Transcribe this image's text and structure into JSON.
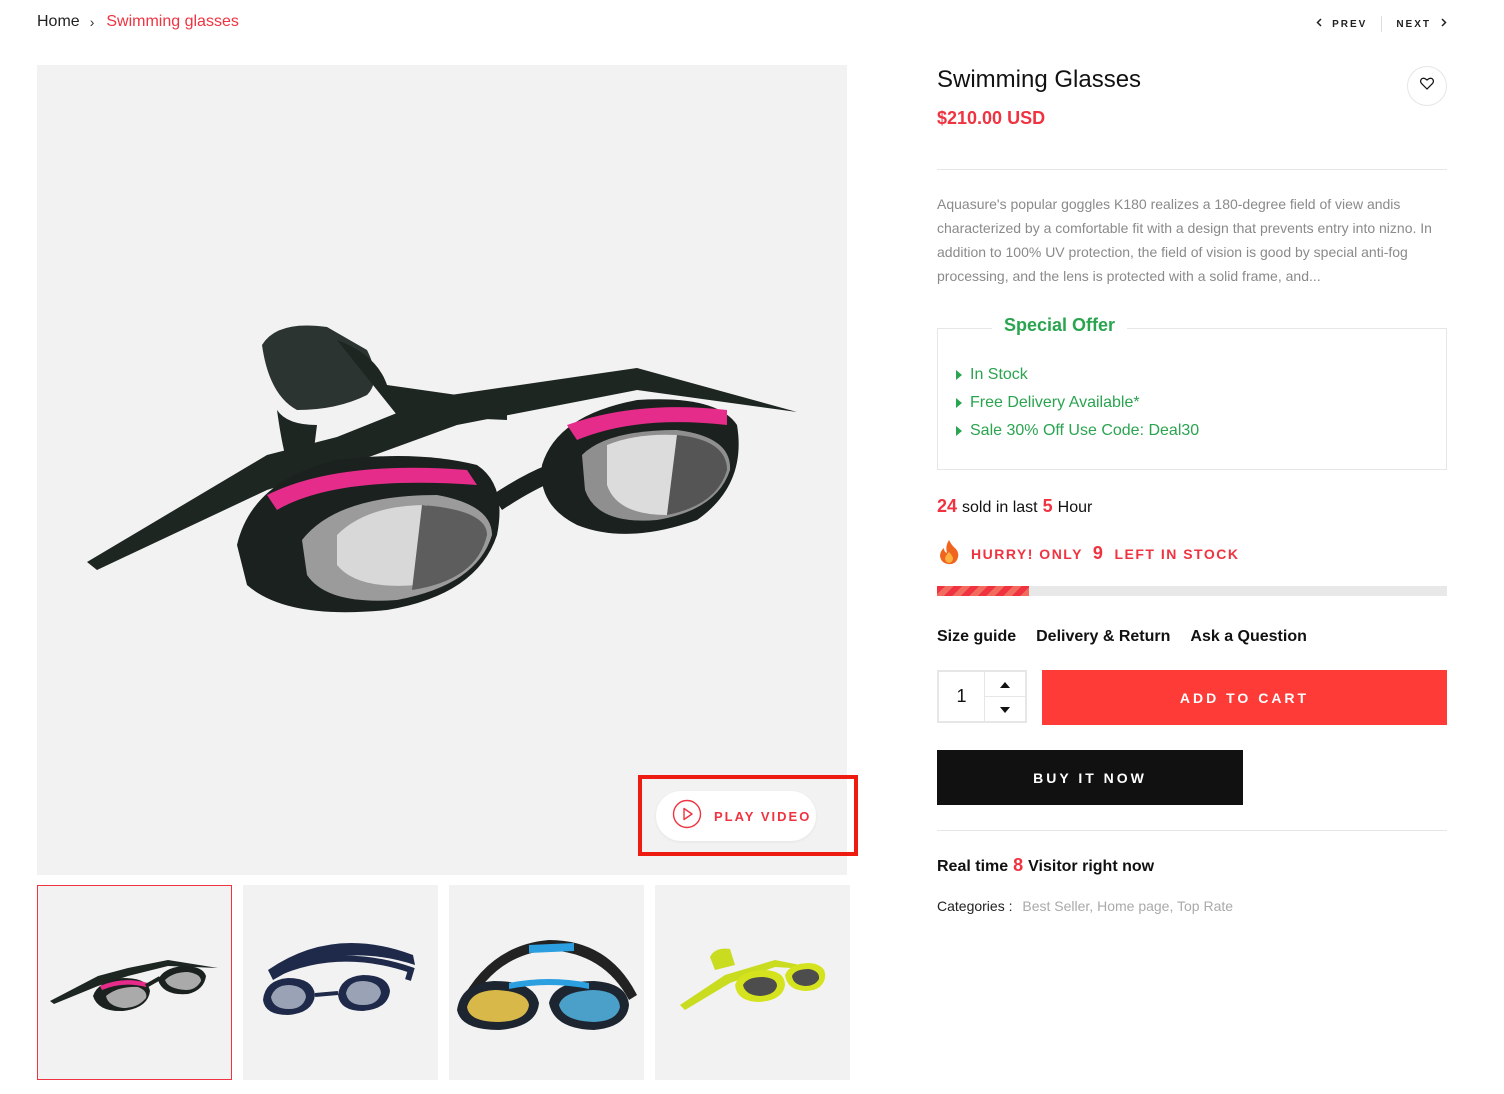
{
  "breadcrumb": {
    "home": "Home",
    "separator": "›",
    "current": "Swimming glasses"
  },
  "pager": {
    "prev": "PREV",
    "next": "NEXT"
  },
  "gallery": {
    "play_video": "PLAY VIDEO",
    "thumbnails": [
      "goggles-pink-black",
      "goggles-navy",
      "goggles-blue-yellow",
      "goggles-yellow-green"
    ]
  },
  "product": {
    "title": "Swimming Glasses",
    "price": "$210.00 USD",
    "description": "Aquasure's popular goggles K180 realizes a 180-degree field of view andis characterized by a comfortable fit with a design that prevents entry into nizno. In addition to 100% UV protection, the field of vision is good by special anti-fog processing, and the lens is protected with a solid frame, and...",
    "special_offer": {
      "title": "Special Offer",
      "items": [
        "In Stock",
        "Free Delivery Available*",
        "Sale 30% Off Use Code: Deal30"
      ]
    },
    "sold": {
      "count": "24",
      "text1": "sold in last",
      "hours": "5",
      "text2": "Hour"
    },
    "hurry": {
      "text1": "HURRY! ONLY",
      "count": "9",
      "text2": "LEFT IN STOCK",
      "stock_fraction": 0.18
    },
    "links": [
      "Size guide",
      "Delivery & Return",
      "Ask a Question"
    ],
    "quantity": "1",
    "add_to_cart": "ADD TO CART",
    "buy_now": "BUY IT NOW",
    "visitors": {
      "text1": "Real time",
      "count": "8",
      "text2": "Visitor right now"
    },
    "categories": {
      "label": "Categories :",
      "items": [
        "Best Seller,",
        "Home page,",
        "Top Rate"
      ]
    }
  },
  "colors": {
    "accent": "#ef3340",
    "green": "#2aa44f",
    "dark": "#111111",
    "highlight_box": "#ee1c10"
  }
}
